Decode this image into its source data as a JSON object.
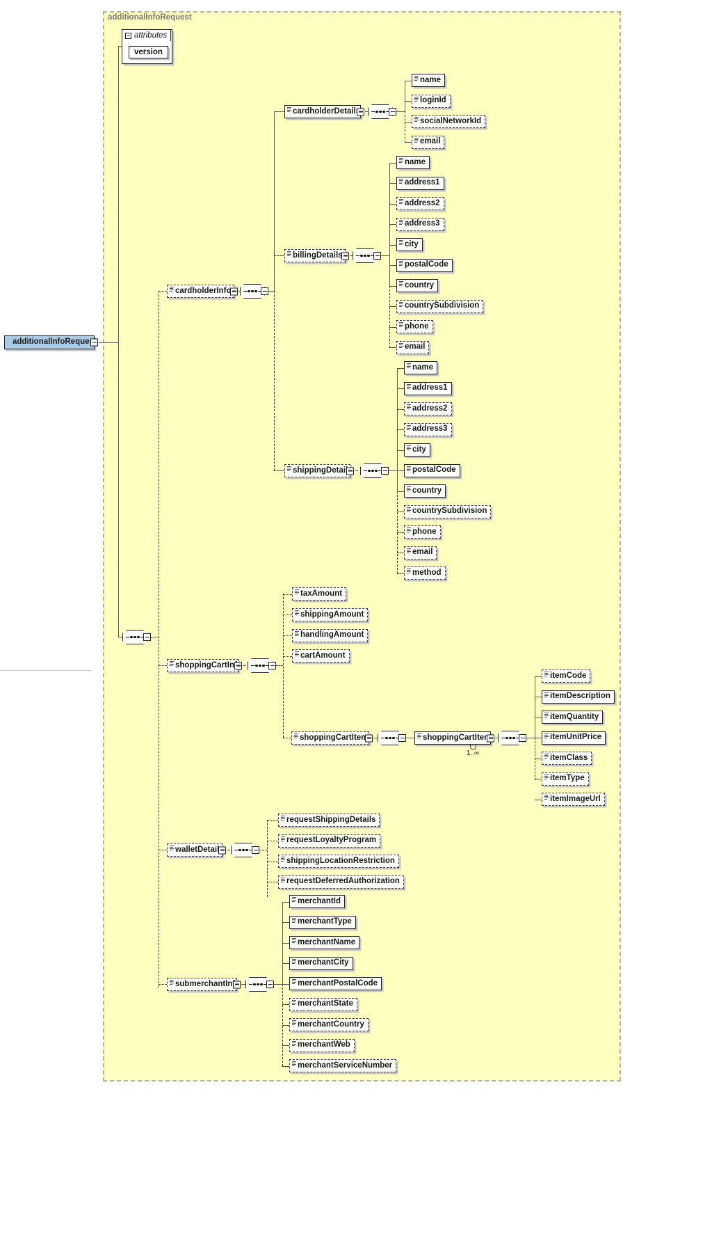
{
  "diagram": {
    "title": "additionalInfoRequest",
    "group_label": "additionalInfoRequest",
    "root_element": "additionalInfoRequest",
    "colors": {
      "group_background": "#ffffbf",
      "root_node": "#a8cbe8",
      "node_background": "#fdfdfa",
      "border": "#22222a",
      "shadow": "#c4c4c4"
    }
  },
  "attributes": {
    "label": "attributes",
    "items": [
      {
        "name": "version"
      }
    ]
  },
  "nodes": {
    "cardholderInfo": "cardholderInfo",
    "cardholderDetails": "cardholderDetails",
    "billingDetails": "billingDetails",
    "shippingDetails": "shippingDetails",
    "shoppingCartInfo": "shoppingCartInfo",
    "shoppingCartItems": "shoppingCartItems",
    "shoppingCartItem": "shoppingCartItem",
    "walletDetails": "walletDetails",
    "submerchantInfo": "submerchantInfo"
  },
  "cardinality": {
    "shoppingCartItem": "1..∞"
  },
  "cardholderDetails_children": [
    {
      "name": "name",
      "required": true
    },
    {
      "name": "loginId",
      "required": false
    },
    {
      "name": "socialNetworkId",
      "required": false
    },
    {
      "name": "email",
      "required": false
    }
  ],
  "billingDetails_children": [
    {
      "name": "name",
      "required": true
    },
    {
      "name": "address1",
      "required": true
    },
    {
      "name": "address2",
      "required": false
    },
    {
      "name": "address3",
      "required": false
    },
    {
      "name": "city",
      "required": true
    },
    {
      "name": "postalCode",
      "required": true
    },
    {
      "name": "country",
      "required": true
    },
    {
      "name": "countrySubdivision",
      "required": false
    },
    {
      "name": "phone",
      "required": false
    },
    {
      "name": "email",
      "required": false
    }
  ],
  "shippingDetails_children": [
    {
      "name": "name",
      "required": true
    },
    {
      "name": "address1",
      "required": true
    },
    {
      "name": "address2",
      "required": false
    },
    {
      "name": "address3",
      "required": false
    },
    {
      "name": "city",
      "required": true
    },
    {
      "name": "postalCode",
      "required": true
    },
    {
      "name": "country",
      "required": true
    },
    {
      "name": "countrySubdivision",
      "required": false
    },
    {
      "name": "phone",
      "required": false
    },
    {
      "name": "email",
      "required": false
    },
    {
      "name": "method",
      "required": false
    }
  ],
  "shoppingCartInfo_children": [
    {
      "name": "taxAmount",
      "required": false
    },
    {
      "name": "shippingAmount",
      "required": false
    },
    {
      "name": "handlingAmount",
      "required": false
    },
    {
      "name": "cartAmount",
      "required": false
    }
  ],
  "shoppingCartItem_children": [
    {
      "name": "itemCode",
      "required": false
    },
    {
      "name": "itemDescription",
      "required": true
    },
    {
      "name": "itemQuantity",
      "required": true
    },
    {
      "name": "itemUnitPrice",
      "required": true
    },
    {
      "name": "itemClass",
      "required": false
    },
    {
      "name": "itemType",
      "required": false
    },
    {
      "name": "itemImageUrl",
      "required": false
    }
  ],
  "walletDetails_children": [
    {
      "name": "requestShippingDetails",
      "required": false
    },
    {
      "name": "requestLoyaltyProgram",
      "required": false
    },
    {
      "name": "shippingLocationRestriction",
      "required": false
    },
    {
      "name": "requestDeferredAuthorization",
      "required": false
    }
  ],
  "submerchantInfo_children": [
    {
      "name": "merchantId",
      "required": true
    },
    {
      "name": "merchantType",
      "required": true
    },
    {
      "name": "merchantName",
      "required": true
    },
    {
      "name": "merchantCity",
      "required": true
    },
    {
      "name": "merchantPostalCode",
      "required": true
    },
    {
      "name": "merchantState",
      "required": false
    },
    {
      "name": "merchantCountry",
      "required": false
    },
    {
      "name": "merchantWeb",
      "required": false
    },
    {
      "name": "merchantServiceNumber",
      "required": false
    }
  ]
}
